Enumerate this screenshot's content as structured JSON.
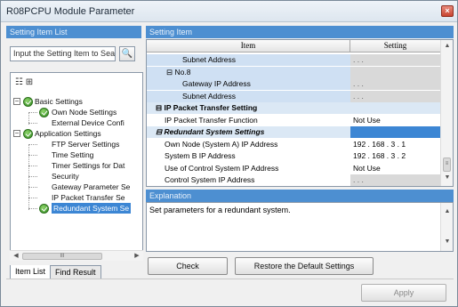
{
  "window": {
    "title": "R08PCPU Module Parameter",
    "close_label": "×"
  },
  "left": {
    "header": "Setting Item List",
    "search_placeholder": "Input the Setting Item to Sea",
    "toolbar_glyph": "☷ ⊞",
    "tree": [
      {
        "label": "Basic Settings",
        "level": 0,
        "expander": "⊟"
      },
      {
        "label": "Own Node Settings",
        "level": 1
      },
      {
        "label": "External Device Confi",
        "level": 1
      },
      {
        "label": "Application Settings",
        "level": 0,
        "expander": "⊟"
      },
      {
        "label": "FTP Server Settings",
        "level": 1
      },
      {
        "label": "Time Setting",
        "level": 1
      },
      {
        "label": "Timer Settings for Dat",
        "level": 1
      },
      {
        "label": "Security",
        "level": 1
      },
      {
        "label": "Gateway Parameter Se",
        "level": 1
      },
      {
        "label": "IP Packet Transfer Se",
        "level": 1
      },
      {
        "label": "Redundant System Se",
        "level": 1,
        "selected": true
      }
    ],
    "tabs": {
      "item_list": "Item List",
      "find_result": "Find Result"
    },
    "scroll_thumb": "III"
  },
  "right": {
    "header": "Setting Item",
    "columns": {
      "item": "Item",
      "setting": "Setting"
    },
    "rows": [
      {
        "item": "Subnet Address",
        "setting": ". . .",
        "kind": "sub",
        "indent": 40
      },
      {
        "item": "No.8",
        "setting": "",
        "kind": "sub",
        "indent": 22,
        "expander": "⊟"
      },
      {
        "item": "Gateway IP Address",
        "setting": ". . .",
        "kind": "sub",
        "indent": 40
      },
      {
        "item": "Subnet Address",
        "setting": ". . .",
        "kind": "sub",
        "indent": 40
      },
      {
        "item": "IP Packet Transfer Setting",
        "setting": "",
        "kind": "cat-plain",
        "indent": 10,
        "expander": "⊟"
      },
      {
        "item": "IP Packet Transfer Function",
        "setting": "Not Use",
        "kind": "item",
        "indent": 20
      },
      {
        "item": "Redundant System Settings",
        "setting": "",
        "kind": "cat",
        "indent": 10,
        "expander": "⊟"
      },
      {
        "item": "Own Node (System A) IP Address",
        "setting": "192 . 168 .   3 .   1",
        "kind": "ip-white",
        "indent": 20
      },
      {
        "item": "System B IP Address",
        "setting": "192 . 168 .   3 .   2",
        "kind": "ip-white",
        "indent": 20
      },
      {
        "item": "Use of Control System IP Address",
        "setting": "Not Use",
        "kind": "item",
        "indent": 20
      },
      {
        "item": "Control System IP Address",
        "setting": ". . .",
        "kind": "ip-gray",
        "indent": 20
      }
    ],
    "explanation_header": "Explanation",
    "explanation_text": "Set parameters for a redundant system."
  },
  "buttons": {
    "check": "Check",
    "restore": "Restore the Default Settings",
    "apply": "Apply"
  }
}
